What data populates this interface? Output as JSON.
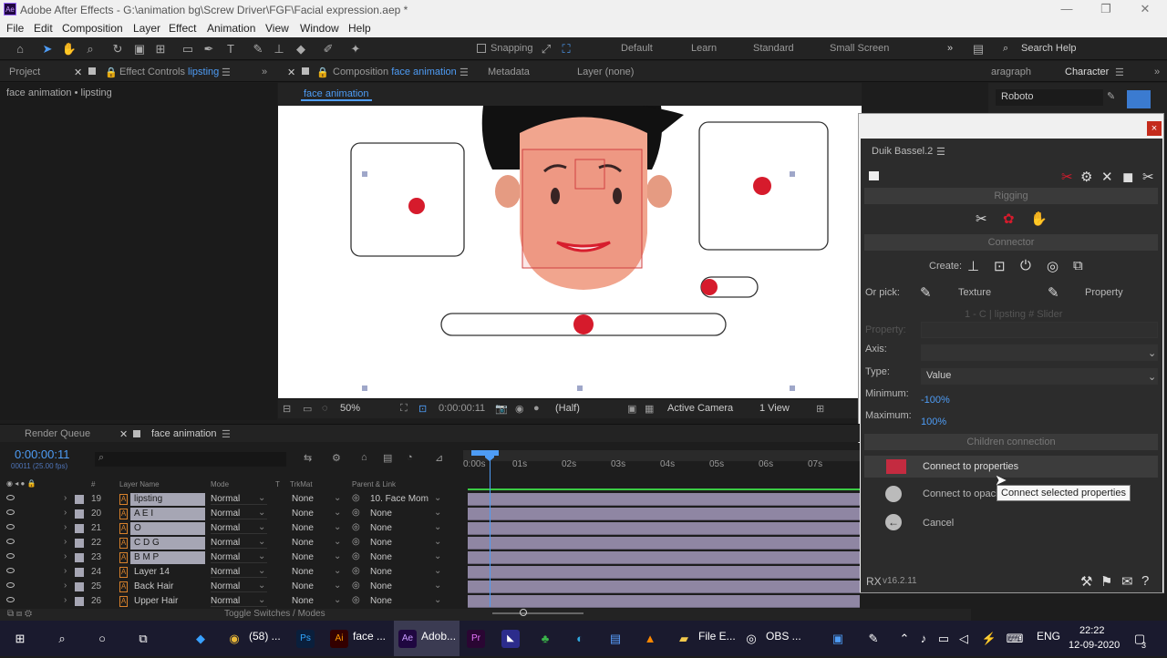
{
  "title": {
    "app": "Adobe After Effects - G:\\animation bg\\Screw Driver\\FGF\\Facial expression.aep *",
    "controls": [
      "—",
      "❐",
      "✕"
    ]
  },
  "menu": [
    "File",
    "Edit",
    "Composition",
    "Layer",
    "Effect",
    "Animation",
    "View",
    "Window",
    "Help"
  ],
  "toolbar": {
    "snapping": "Snapping",
    "workspaces": [
      "Default",
      "Learn",
      "Standard",
      "Small Screen"
    ],
    "search": "Search Help"
  },
  "panels": {
    "project": "Project",
    "effect_controls": "Effect Controls",
    "effect_controls_layer": "lipsting",
    "breadcrumb": "face animation • lipsting",
    "composition": "Composition",
    "composition_name": "face animation",
    "metadata": "Metadata",
    "layer": "Layer (none)",
    "comp_tab": "face animation",
    "paragraph": "aragraph",
    "character": "Character",
    "font": "Roboto"
  },
  "viewer": {
    "zoom": "50%",
    "timecode": "0:00:00:11",
    "resolution": "(Half)",
    "camera": "Active Camera",
    "views": "1 View"
  },
  "duik": {
    "title": "Duik Bassel.2",
    "rigging": "Rigging",
    "connector": "Connector",
    "create": "Create:",
    "or_pick": "Or pick:",
    "texture": "Texture",
    "property": "Property",
    "property_label": "Property:",
    "property_value": "1 - C | lipsting # Slider",
    "axis": "Axis:",
    "type": "Type:",
    "type_value": "Value",
    "minimum": "Minimum:",
    "minimum_value": "-100%",
    "maximum": "Maximum:",
    "maximum_value": "100%",
    "children": "Children connection",
    "connect_props": "Connect to properties",
    "connect_opacity": "Connect to opacity",
    "cancel": "Cancel",
    "tooltip": "Connect selected properties",
    "version": "v16.2.11"
  },
  "timeline": {
    "render_queue": "Render Queue",
    "comp": "face animation",
    "timecode": "0:00:00:11",
    "fps": "00011 (25.00 fps)",
    "cols": {
      "num": "#",
      "name": "Layer Name",
      "mode": "Mode",
      "t": "T",
      "trkmat": "TrkMat",
      "parent": "Parent & Link"
    },
    "ticks": [
      "0:00s",
      "01s",
      "02s",
      "03s",
      "04s",
      "05s",
      "06s",
      "07s"
    ],
    "toggle": "Toggle Switches / Modes",
    "layers": [
      {
        "num": "19",
        "name": "lipsting",
        "mode": "Normal",
        "trk": "None",
        "parent": "10. Face Mom"
      },
      {
        "num": "20",
        "name": "A E I",
        "mode": "Normal",
        "trk": "None",
        "parent": "None"
      },
      {
        "num": "21",
        "name": "O",
        "mode": "Normal",
        "trk": "None",
        "parent": "None"
      },
      {
        "num": "22",
        "name": "C D G",
        "mode": "Normal",
        "trk": "None",
        "parent": "None"
      },
      {
        "num": "23",
        "name": "B M P",
        "mode": "Normal",
        "trk": "None",
        "parent": "None"
      },
      {
        "num": "24",
        "name": "Layer 14",
        "mode": "Normal",
        "trk": "None",
        "parent": "None"
      },
      {
        "num": "25",
        "name": "Back Hair",
        "mode": "Normal",
        "trk": "None",
        "parent": "None"
      },
      {
        "num": "26",
        "name": "Upper Hair",
        "mode": "Normal",
        "trk": "None",
        "parent": "None"
      }
    ]
  },
  "taskbar": {
    "chrome": "(58) ...",
    "illustrator": "face ...",
    "ae": "Adob...",
    "file_explorer": "File E...",
    "obs": "OBS ...",
    "lang": "ENG",
    "time": "22:22",
    "date": "12-09-2020",
    "notif": "3"
  }
}
